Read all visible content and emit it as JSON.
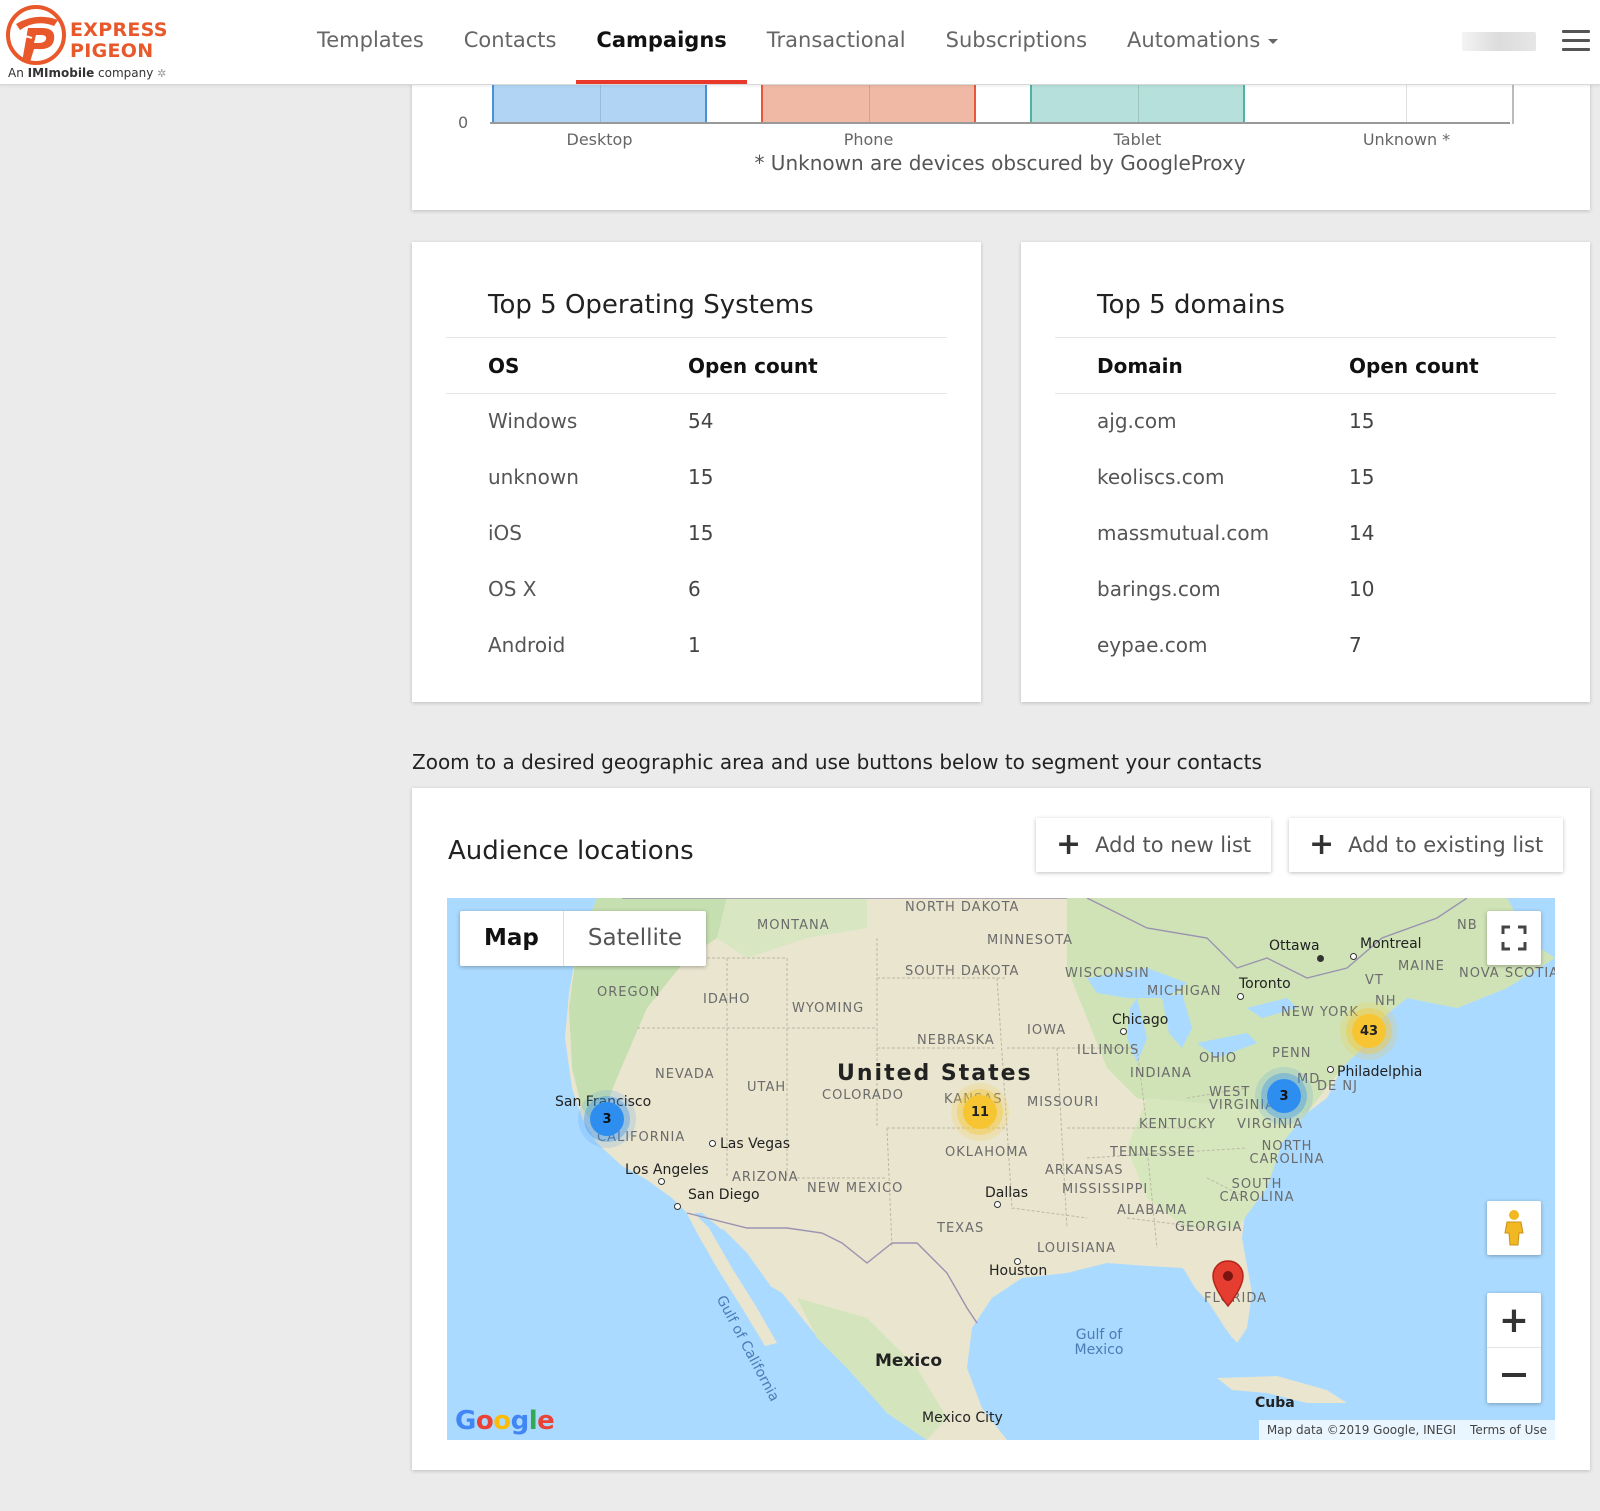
{
  "header": {
    "logo_line1": "EXPRESS",
    "logo_line2": "PIGEON",
    "logo_sub_prefix": "An ",
    "logo_sub_brand": "IMImobile",
    "logo_sub_suffix": " company",
    "nav": [
      "Templates",
      "Contacts",
      "Campaigns",
      "Transactional",
      "Subscriptions",
      "Automations"
    ],
    "active_nav": "Campaigns"
  },
  "device_chart": {
    "chart_data": {
      "type": "bar",
      "categories": [
        "Desktop",
        "Phone",
        "Tablet",
        "Unknown *"
      ],
      "y_tick_visible": "0",
      "colors": [
        "#4a90d9",
        "#e8583a",
        "#4fb3a4",
        "#999999"
      ],
      "fills": [
        "#b1d4f5",
        "#f0b9a6",
        "#b6e0db",
        "#ffffff"
      ]
    },
    "note": "* Unknown are devices obscured by GoogleProxy"
  },
  "os_table": {
    "title": "Top 5 Operating Systems",
    "headers": [
      "OS",
      "Open count"
    ],
    "rows": [
      [
        "Windows",
        "54"
      ],
      [
        "unknown",
        "15"
      ],
      [
        "iOS",
        "15"
      ],
      [
        "OS X",
        "6"
      ],
      [
        "Android",
        "1"
      ]
    ]
  },
  "domain_table": {
    "title": "Top 5 domains",
    "headers": [
      "Domain",
      "Open count"
    ],
    "rows": [
      [
        "ajg.com",
        "15"
      ],
      [
        "keoliscs.com",
        "15"
      ],
      [
        "massmutual.com",
        "14"
      ],
      [
        "barings.com",
        "10"
      ],
      [
        "eypae.com",
        "7"
      ]
    ]
  },
  "map_section": {
    "hint": "Zoom to a desired geographic area and use buttons below to segment your contacts",
    "title": "Audience locations",
    "add_new": "Add to new list",
    "add_existing": "Add to existing list",
    "map_type": [
      "Map",
      "Satellite"
    ],
    "country": "United States",
    "mexico": "Mexico",
    "cuba": "Cuba",
    "gulf": "Gulf of Mexico",
    "gulf_ca": "Gulf of California",
    "states": [
      "MONTANA",
      "NORTH DAKOTA",
      "MINNESOTA",
      "SOUTH DAKOTA",
      "WISCONSIN",
      "MICHIGAN",
      "OREGON",
      "IDAHO",
      "WYOMING",
      "NEBRASKA",
      "IOWA",
      "ILLINOIS",
      "INDIANA",
      "OHIO",
      "PENN",
      "NEVADA",
      "UTAH",
      "COLORADO",
      "KANSAS",
      "MISSOURI",
      "WEST VIRGINIA",
      "VIRGINIA",
      "KENTUCKY",
      "CALIFORNIA",
      "OKLAHOMA",
      "TENNESSEE",
      "NORTH CAROLINA",
      "ARIZONA",
      "NEW MEXICO",
      "ARKANSAS",
      "MISSISSIPPI",
      "SOUTH CAROLINA",
      "ALABAMA",
      "GEORGIA",
      "TEXAS",
      "LOUISIANA",
      "FLORIDA",
      "NEW YORK",
      "VT",
      "NH",
      "MAINE",
      "NB",
      "NOVA SCOTIA",
      "MD",
      "DE NJ"
    ],
    "cities": [
      "Ottawa",
      "Montreal",
      "Toronto",
      "Chicago",
      "Philadelphia",
      "San Francisco",
      "Las Vegas",
      "Los Angeles",
      "San Diego",
      "Dallas",
      "Houston",
      "Mexico City"
    ],
    "clusters": [
      {
        "count": "3",
        "color": "blue",
        "near": "San Francisco"
      },
      {
        "count": "11",
        "color": "yellow",
        "near": "Kansas"
      },
      {
        "count": "3",
        "color": "blue",
        "near": "Virginia"
      },
      {
        "count": "43",
        "color": "yellow",
        "near": "New York"
      }
    ],
    "google_logo": "Google",
    "map_data": "Map data ©2019 Google, INEGI",
    "terms": "Terms of Use"
  }
}
